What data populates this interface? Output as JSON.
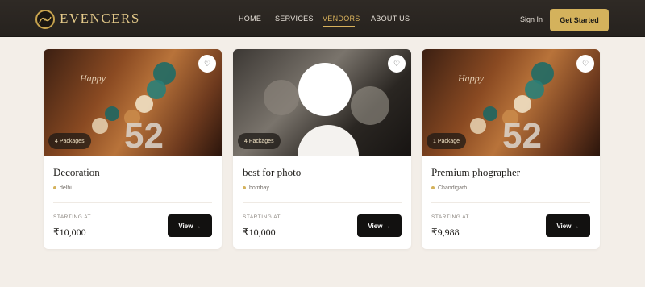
{
  "header": {
    "brand": "EVENCERS",
    "nav": [
      "HOME",
      "SERVICES",
      "VENDORS",
      "ABOUT US"
    ],
    "active_nav": "VENDORS",
    "signin": "Sign In",
    "cta": "Get Started"
  },
  "cards": [
    {
      "packages": "4 Packages",
      "title": "Decoration",
      "location": "delhi",
      "starting_label": "STARTING AT",
      "price": "₹10,000",
      "view": "View →",
      "image": "party-decoration"
    },
    {
      "packages": "4 Packages",
      "title": "best for photo",
      "location": "bombay",
      "starting_label": "STARTING AT",
      "price": "₹10,000",
      "view": "View →",
      "image": "bw-photo"
    },
    {
      "packages": "1 Package",
      "title": "Premium phographer",
      "location": "Chandigarh",
      "starting_label": "STARTING AT",
      "price": "₹9,988",
      "view": "View →",
      "image": "party-decoration"
    }
  ],
  "colors": {
    "accent": "#d4b25c",
    "nav_bg": "#2b2622",
    "page_bg": "#f3eee8"
  }
}
